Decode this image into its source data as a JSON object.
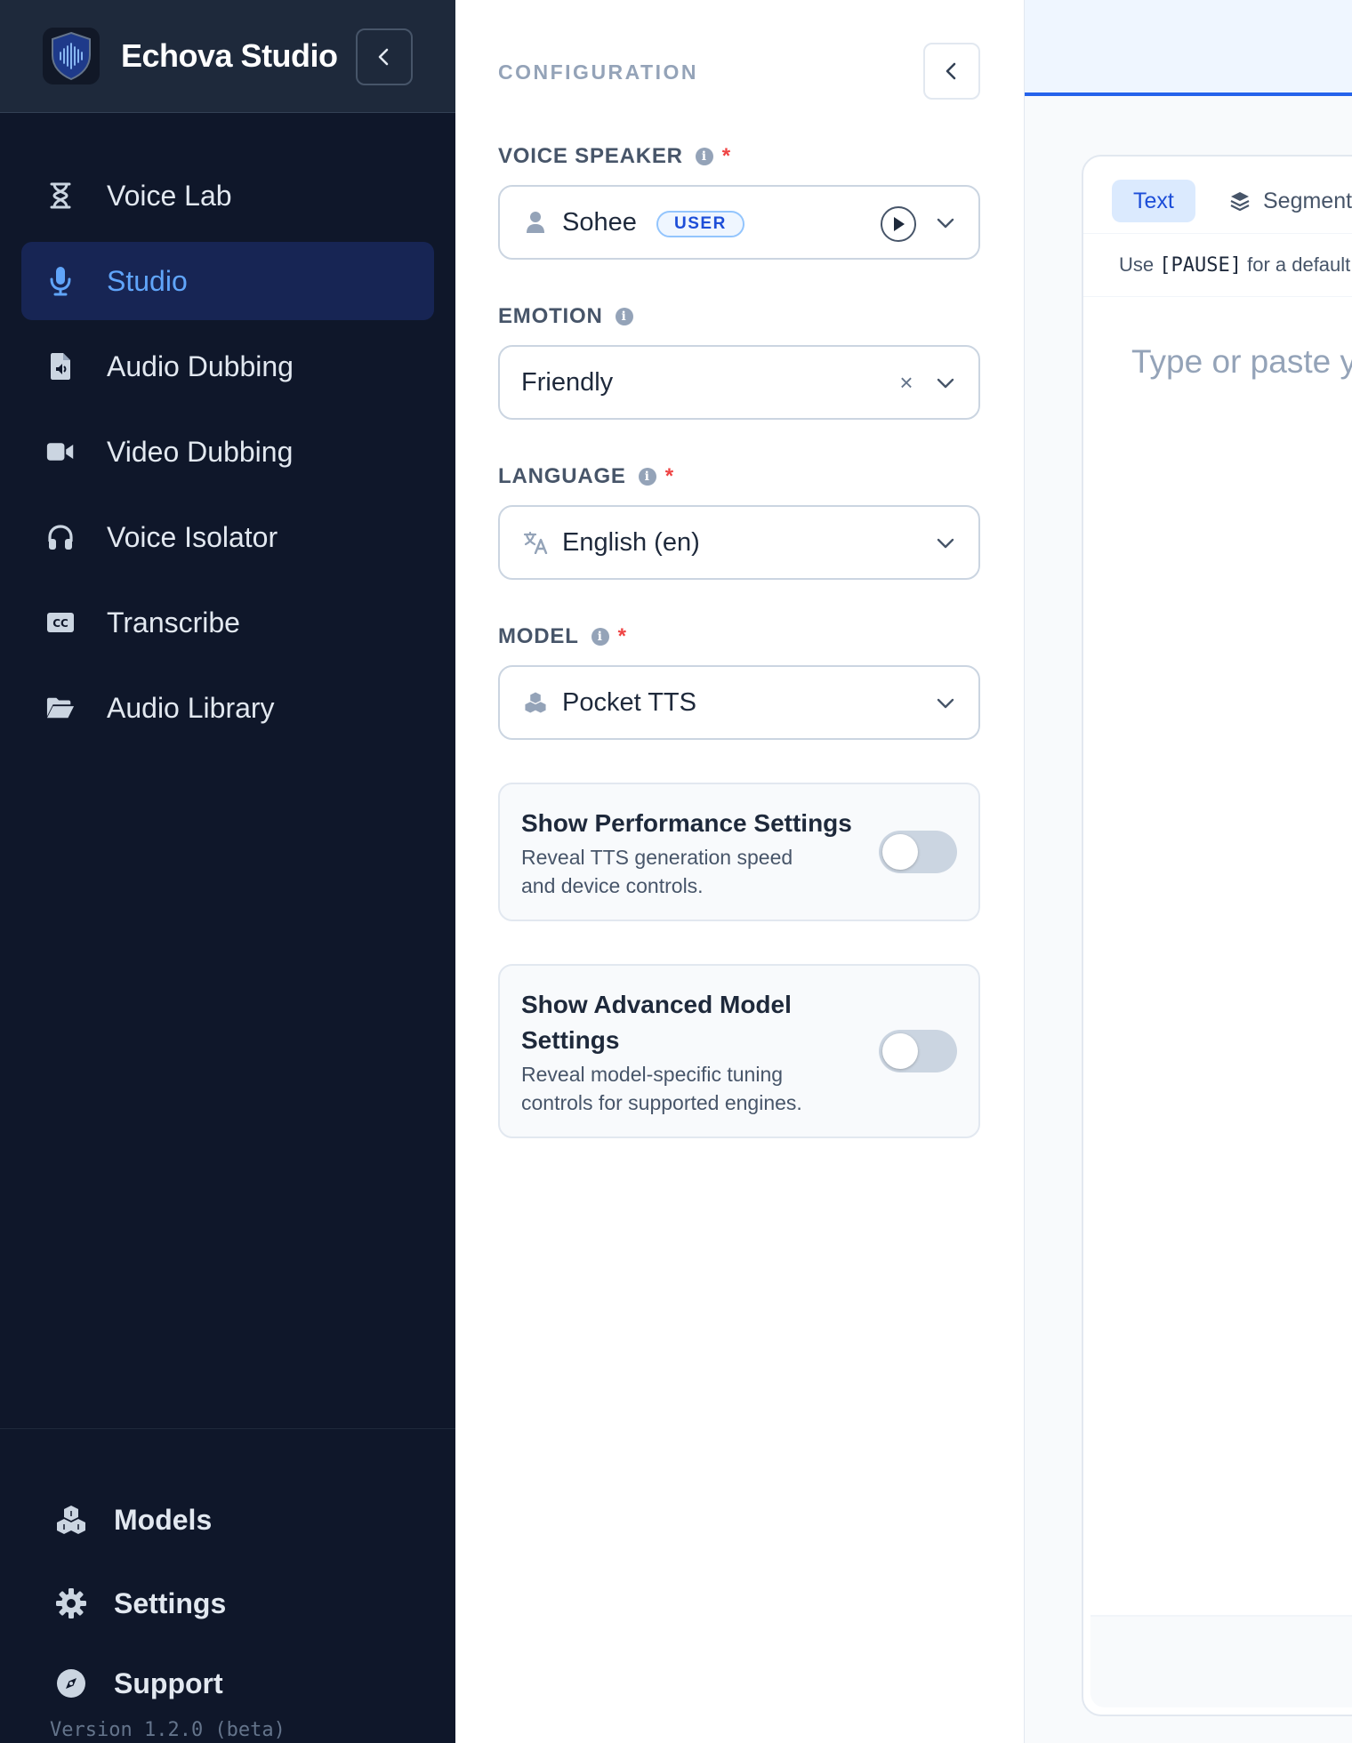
{
  "app": {
    "name": "Echova Studio",
    "version": "Version 1.2.0 (beta)"
  },
  "sidebar": {
    "items": [
      {
        "label": "Voice Lab",
        "icon": "hourglass-icon",
        "active": false
      },
      {
        "label": "Studio",
        "icon": "microphone-icon",
        "active": true
      },
      {
        "label": "Audio Dubbing",
        "icon": "audio-file-icon",
        "active": false
      },
      {
        "label": "Video Dubbing",
        "icon": "video-camera-icon",
        "active": false
      },
      {
        "label": "Voice Isolator",
        "icon": "headphones-icon",
        "active": false
      },
      {
        "label": "Transcribe",
        "icon": "closed-captions-icon",
        "active": false
      },
      {
        "label": "Audio Library",
        "icon": "folder-open-icon",
        "active": false
      }
    ],
    "bottom": [
      {
        "label": "Models",
        "icon": "cubes-icon"
      },
      {
        "label": "Settings",
        "icon": "gear-icon"
      },
      {
        "label": "Support",
        "icon": "compass-icon"
      }
    ]
  },
  "config": {
    "title": "CONFIGURATION",
    "voice_speaker": {
      "label": "VOICE SPEAKER",
      "required_mark": "*",
      "value": "Sohee",
      "badge": "USER"
    },
    "emotion": {
      "label": "EMOTION",
      "value": "Friendly",
      "clear_glyph": "×"
    },
    "language": {
      "label": "LANGUAGE",
      "required_mark": "*",
      "value": "English (en)"
    },
    "model": {
      "label": "MODEL",
      "required_mark": "*",
      "value": "Pocket TTS"
    },
    "performance": {
      "title": "Show Performance Settings",
      "desc_line1": "Reveal TTS generation speed",
      "desc_line2": "and device controls.",
      "enabled": false
    },
    "advanced": {
      "title_line1": "Show Advanced Model",
      "title_line2": "Settings",
      "desc_line1": "Reveal model-specific tuning",
      "desc_line2": "controls for supported engines.",
      "enabled": false
    }
  },
  "editor": {
    "tabs": [
      {
        "label": "Text",
        "active": true
      },
      {
        "label": "Segments",
        "active": false
      }
    ],
    "hint_prefix": "Use",
    "hint_code": "[PAUSE]",
    "hint_suffix": "for a default pause",
    "placeholder": "Type or paste your text"
  },
  "colors": {
    "sidebar_bg": "#0f172a",
    "accent": "#2563eb",
    "active_text": "#60a5fa",
    "required": "#ef4444"
  }
}
